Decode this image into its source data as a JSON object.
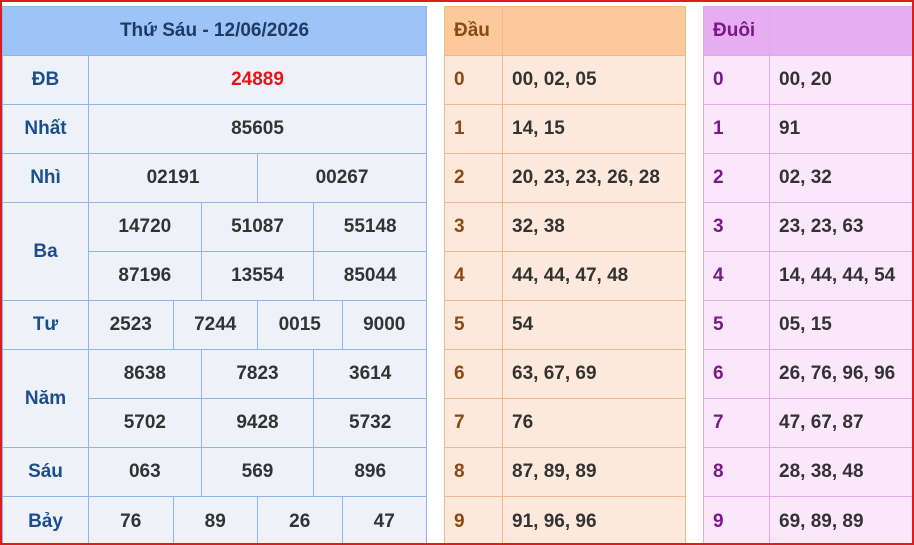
{
  "results": {
    "header": "Thứ Sáu - 12/06/2026",
    "rows": [
      {
        "label": "ĐB",
        "lines": [
          [
            "24889"
          ]
        ]
      },
      {
        "label": "Nhất",
        "lines": [
          [
            "85605"
          ]
        ]
      },
      {
        "label": "Nhì",
        "lines": [
          [
            "02191",
            "00267"
          ]
        ]
      },
      {
        "label": "Ba",
        "lines": [
          [
            "14720",
            "51087",
            "55148"
          ],
          [
            "87196",
            "13554",
            "85044"
          ]
        ]
      },
      {
        "label": "Tư",
        "lines": [
          [
            "2523",
            "7244",
            "0015",
            "9000"
          ]
        ]
      },
      {
        "label": "Năm",
        "lines": [
          [
            "8638",
            "7823",
            "3614"
          ],
          [
            "5702",
            "9428",
            "5732"
          ]
        ]
      },
      {
        "label": "Sáu",
        "lines": [
          [
            "063",
            "569",
            "896"
          ]
        ]
      },
      {
        "label": "Bảy",
        "lines": [
          [
            "76",
            "89",
            "26",
            "47"
          ]
        ]
      }
    ]
  },
  "dau": {
    "header": "Đầu",
    "rows": [
      {
        "key": "0",
        "values": "00, 02, 05"
      },
      {
        "key": "1",
        "values": "14, 15"
      },
      {
        "key": "2",
        "values": "20, 23, 23, 26, 28"
      },
      {
        "key": "3",
        "values": "32, 38"
      },
      {
        "key": "4",
        "values": "44, 44, 47, 48"
      },
      {
        "key": "5",
        "values": "54"
      },
      {
        "key": "6",
        "values": "63, 67, 69"
      },
      {
        "key": "7",
        "values": "76"
      },
      {
        "key": "8",
        "values": "87, 89, 89"
      },
      {
        "key": "9",
        "values": "91, 96, 96"
      }
    ]
  },
  "duoi": {
    "header": "Đuôi",
    "rows": [
      {
        "key": "0",
        "values": "00, 20"
      },
      {
        "key": "1",
        "values": "91"
      },
      {
        "key": "2",
        "values": "02, 32"
      },
      {
        "key": "3",
        "values": "23, 23, 63"
      },
      {
        "key": "4",
        "values": "14, 44, 44, 54"
      },
      {
        "key": "5",
        "values": "05, 15"
      },
      {
        "key": "6",
        "values": "26, 76, 96, 96"
      },
      {
        "key": "7",
        "values": "47, 67, 87"
      },
      {
        "key": "8",
        "values": "28, 38, 48"
      },
      {
        "key": "9",
        "values": "69, 89, 89"
      }
    ]
  },
  "colors": {
    "frame": "#e01b1b",
    "results_header": "#9dc3f7",
    "special_prize": "#e8141b",
    "dau_header": "#fcc99b",
    "duoi_header": "#e6aef0"
  }
}
